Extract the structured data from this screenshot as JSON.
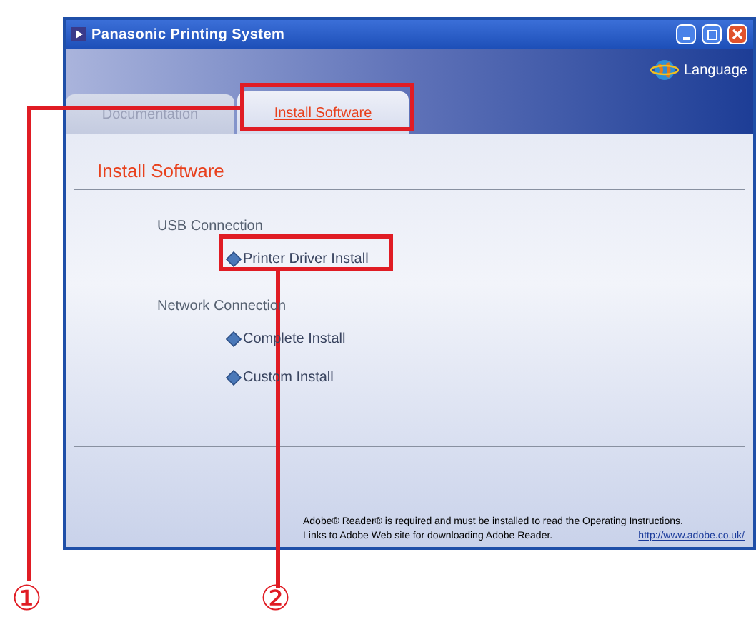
{
  "window": {
    "title": "Panasonic Printing System"
  },
  "language_link": "Language",
  "tabs": [
    {
      "label": "Documentation",
      "selected": false
    },
    {
      "label": "Install Software",
      "selected": true
    }
  ],
  "section_title": "Install Software",
  "groups": [
    {
      "label": "USB Connection",
      "items": [
        "Printer Driver Install"
      ]
    },
    {
      "label": "Network Connection",
      "items": [
        "Complete Install",
        "Custom Install"
      ]
    }
  ],
  "footer": {
    "lines": [
      "Adobe® Reader® is required and must be installed to read the Operating Instructions.",
      "Links to Adobe Web site for downloading Adobe Reader."
    ],
    "link": "http://www.adobe.co.uk/"
  },
  "callouts": [
    {
      "label": "①"
    },
    {
      "label": "②"
    }
  ]
}
